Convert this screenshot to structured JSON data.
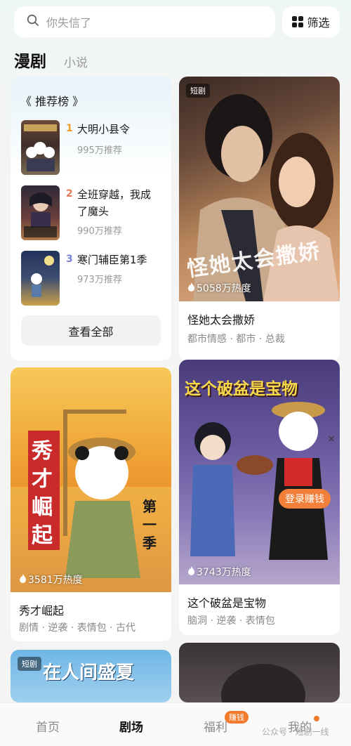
{
  "search": {
    "placeholder": "你失信了"
  },
  "filter": {
    "label": "筛选"
  },
  "category_tabs": [
    {
      "label": "漫剧",
      "active": true
    },
    {
      "label": "小说",
      "active": false
    }
  ],
  "ranking": {
    "title": "《 推荐榜 》",
    "items": [
      {
        "rank": "1",
        "name": "大明小县令",
        "heat": "995万推荐",
        "rank_color": "#f29b2a"
      },
      {
        "rank": "2",
        "name": "全班穿越，我成了魔头",
        "heat": "990万推荐",
        "rank_color": "#e27a55"
      },
      {
        "rank": "3",
        "name": "寒门辅臣第1季",
        "heat": "973万推荐",
        "rank_color": "#7a83d6"
      }
    ],
    "view_all": "查看全部"
  },
  "cards": [
    {
      "badge": "短剧",
      "poster_text": "怪她太会撒娇",
      "heat": "5058万热度",
      "title": "怪她太会撒娇",
      "tags": "都市情感 · 都市 · 总裁"
    },
    {
      "badge": "",
      "poster_text": "秀才崛起",
      "poster_side": "第一季",
      "heat": "3581万热度",
      "title": "秀才崛起",
      "tags": "剧情 · 逆袭 · 表情包 · 古代"
    },
    {
      "badge": "",
      "poster_headline": "这个破盆是宝物",
      "cta": "登录赚钱",
      "heat": "3743万热度",
      "title": "这个破盆是宝物",
      "tags": "脑洞 · 逆袭 · 表情包"
    },
    {
      "badge": "短剧",
      "poster_text": "在人间盛夏"
    }
  ],
  "bottom_nav": {
    "items": [
      {
        "label": "首页",
        "active": false
      },
      {
        "label": "剧场",
        "active": true
      },
      {
        "label": "福利",
        "active": false
      },
      {
        "label": "我的",
        "active": false
      }
    ],
    "welfare_badge": "赚钱"
  },
  "watermark": "公众号 · 短剧一线",
  "colors": {
    "accent": "#f27a2c",
    "background": "#f4f4f5"
  }
}
